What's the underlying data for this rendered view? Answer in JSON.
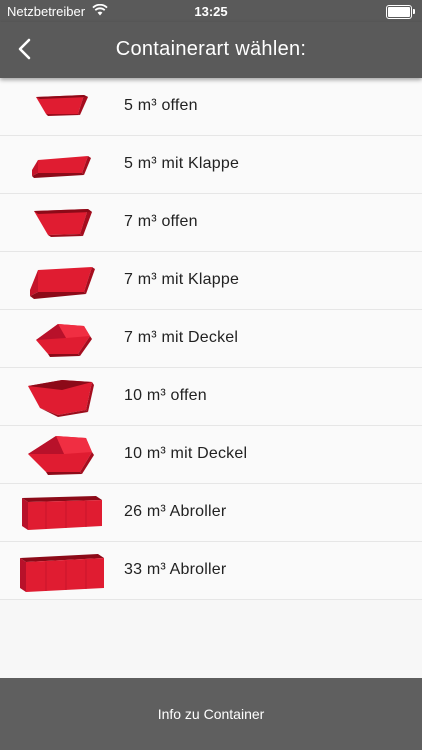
{
  "statusbar": {
    "carrier": "Netzbetreiber",
    "time": "13:25"
  },
  "navbar": {
    "title": "Containerart wählen:",
    "back_icon": "chevron-left-icon"
  },
  "colors": {
    "bar": "#5a5a5a",
    "container_red": "#d4142a"
  },
  "items": [
    {
      "label": "5 m³ offen",
      "icon": "skip-open-small-icon"
    },
    {
      "label": "5 m³ mit Klappe",
      "icon": "skip-flap-small-icon"
    },
    {
      "label": "7 m³ offen",
      "icon": "skip-open-icon"
    },
    {
      "label": "7 m³ mit Klappe",
      "icon": "skip-flap-icon"
    },
    {
      "label": "7 m³ mit Deckel",
      "icon": "skip-lid-icon"
    },
    {
      "label": "10 m³ offen",
      "icon": "skip-open-large-icon"
    },
    {
      "label": "10 m³ mit Deckel",
      "icon": "skip-lid-large-icon"
    },
    {
      "label": "26 m³ Abroller",
      "icon": "rolloff-container-icon"
    },
    {
      "label": "33 m³ Abroller",
      "icon": "rolloff-container-large-icon"
    }
  ],
  "footer": {
    "label": "Info zu Container"
  }
}
